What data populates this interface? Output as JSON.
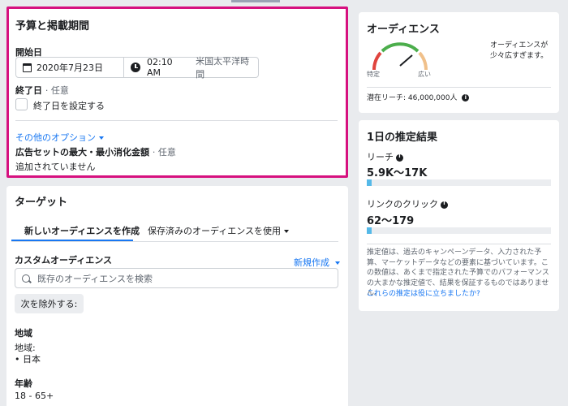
{
  "budget": {
    "title": "予算と掲載期間",
    "start_label": "開始日",
    "start_date": "2020年7月23日",
    "start_time": "02:10 AM",
    "timezone": "米国太平洋時間",
    "end_label": "終了日",
    "end_optional": "· 任意",
    "end_checkbox_label": "終了日を設定する",
    "more_options": "その他のオプション",
    "spend_limit_label": "広告セットの最大・最小消化金額",
    "spend_limit_optional": "· 任意",
    "spend_limit_value": "追加されていません"
  },
  "target": {
    "title": "ターゲット",
    "tabs": [
      {
        "label": "新しいオーディエンスを作成"
      },
      {
        "label": "保存済みのオーディエンスを使用"
      }
    ],
    "custom_audience_label": "カスタムオーディエンス",
    "create_new": "新規作成",
    "search_placeholder": "既存のオーディエンスを検索",
    "exclude_button": "次を除外する:",
    "region_label": "地域",
    "region_sub": "地域:",
    "region_value": "日本",
    "age_label": "年齢",
    "age_value": "18 - 65+"
  },
  "audience": {
    "title": "オーディエンス",
    "description": "オーディエンスが少々広すぎます。",
    "gauge_specific": "特定",
    "gauge_broad": "広い",
    "reach_label": "潜在リーチ:",
    "reach_value": "46,000,000人",
    "gauge_colors": {
      "specific": "#e0443e",
      "mid": "#4cae4c",
      "broad": "#f0c08a"
    }
  },
  "estimate": {
    "title": "1日の推定結果",
    "reach_label": "リーチ",
    "reach_value": "5.9K〜17K",
    "reach_fill": 0.025,
    "clicks_label": "リンクのクリック",
    "clicks_value": "62〜179",
    "clicks_fill": 0.025,
    "disclaimer": "推定値は、過去のキャンペーンデータ、入力された予算、マーケットデータなどの要素に基づいています。この数値は、あくまで指定された予算でのパフォーマンスの大まかな推定値で、結果を保証するものではありません。",
    "feedback_link": "これらの推定は役に立ちましたか?"
  }
}
